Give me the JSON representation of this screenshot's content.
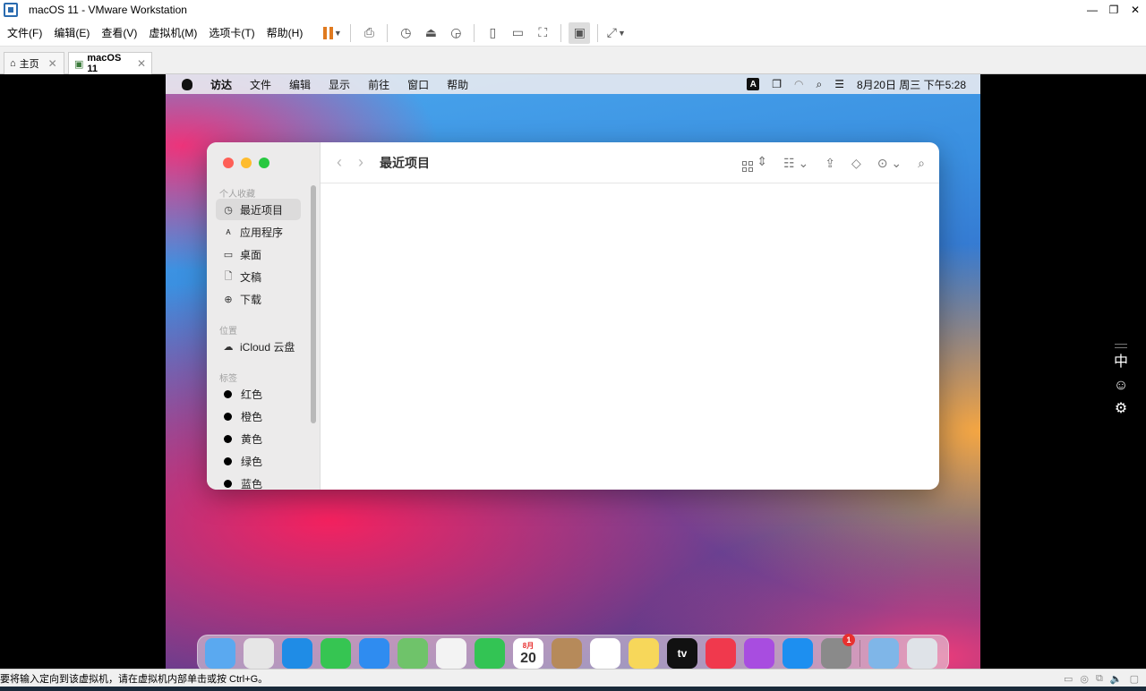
{
  "window": {
    "title": "macOS 11 - VMware Workstation",
    "buttons": [
      "—",
      "❐",
      "✕"
    ]
  },
  "menu": [
    "文件(F)",
    "编辑(E)",
    "查看(V)",
    "虚拟机(M)",
    "选项卡(T)",
    "帮助(H)"
  ],
  "toolbar": {
    "icons": [
      "pause-icon",
      "send-ctrl-alt-del-icon",
      "snapshot-icon",
      "revert-snapshot-icon",
      "snapshot-manager-icon",
      "library-icon",
      "thumbnail-icon",
      "fullscreen-icon",
      "console-icon",
      "unity-icon"
    ]
  },
  "tabs": [
    {
      "label": "主页",
      "close": "✕"
    },
    {
      "label": "macOS 11",
      "close": "✕"
    }
  ],
  "mac_menubar": {
    "items": [
      "访达",
      "文件",
      "编辑",
      "显示",
      "前往",
      "窗口",
      "帮助"
    ],
    "input_badge": "A",
    "datetime": "8月20日 周三 下午5:28"
  },
  "finder": {
    "title": "最近项目",
    "nav_back": "‹",
    "nav_forward": "›",
    "sections": {
      "favorites": "个人收藏",
      "locations": "位置",
      "tags": "标签"
    },
    "favorites": [
      "最近项目",
      "应用程序",
      "桌面",
      "文稿",
      "下载"
    ],
    "favorite_icons": [
      "◷",
      "ᴀ",
      "▭",
      "🗋",
      "⊕"
    ],
    "locations": [
      "iCloud 云盘"
    ],
    "tags": [
      "红色",
      "橙色",
      "黄色",
      "绿色",
      "蓝色"
    ]
  },
  "dock": {
    "apps": [
      {
        "name": "finder",
        "color": "#5aa9f0"
      },
      {
        "name": "launchpad",
        "color": "#e6e6e6"
      },
      {
        "name": "safari",
        "color": "#1f8ce6"
      },
      {
        "name": "messages",
        "color": "#36c552"
      },
      {
        "name": "mail",
        "color": "#2f8cf0"
      },
      {
        "name": "maps",
        "color": "#6fc36a"
      },
      {
        "name": "photos",
        "color": "#f3f3f3"
      },
      {
        "name": "facetime",
        "color": "#33c454"
      },
      {
        "name": "calendar",
        "color": "#ffffff"
      },
      {
        "name": "contacts",
        "color": "#b68a5a"
      },
      {
        "name": "reminders",
        "color": "#ffffff"
      },
      {
        "name": "notes",
        "color": "#f7d75a"
      },
      {
        "name": "tv",
        "color": "#111111"
      },
      {
        "name": "music",
        "color": "#f0394d"
      },
      {
        "name": "podcasts",
        "color": "#a84de0"
      },
      {
        "name": "app-store",
        "color": "#1d8ff0"
      },
      {
        "name": "system-preferences",
        "color": "#8a8a8a"
      },
      {
        "name": "downloads",
        "color": "#7fb6e8"
      },
      {
        "name": "trash",
        "color": "#dfe3e8"
      }
    ],
    "calendar_month": "8月",
    "calendar_day": "20",
    "tv_label": "tv",
    "settings_badge": "1"
  },
  "ime": {
    "grip": "",
    "lang": "中",
    "emoji": "☺",
    "settings": "⚙"
  },
  "status": {
    "text": "要将输入定向到该虚拟机，请在虚拟机内部单击或按 Ctrl+G。"
  }
}
